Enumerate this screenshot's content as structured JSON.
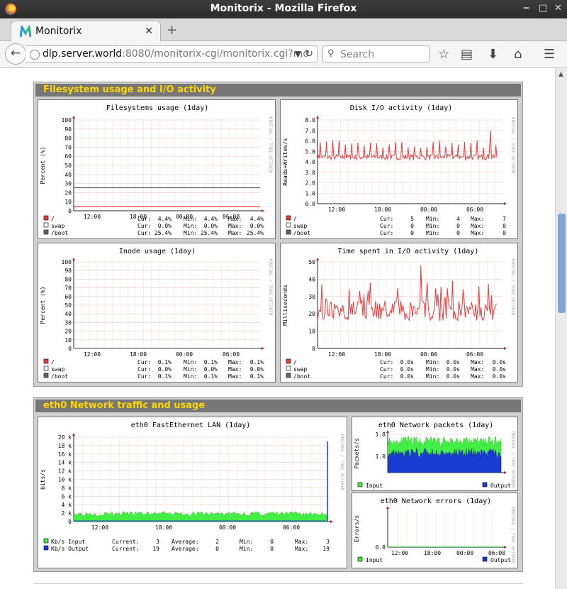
{
  "window": {
    "title": "Monitorix - Mozilla Firefox",
    "min": "‒",
    "max": "□",
    "close": "✕"
  },
  "tab": {
    "label": "Monitorix",
    "close": "✕",
    "new_tab": "+"
  },
  "nav": {
    "url_host": "dlp.server.world",
    "url_rest": ":8080/monitorix-cgi/monitorix.cgi?mo",
    "search_placeholder": "Search"
  },
  "sections": {
    "fs": "Filesystem usage and I/O activity",
    "net": "eth0 Network traffic and usage"
  },
  "watermark": "RRDTOOL / TOBI OETIKER",
  "colors": {
    "red": "#e83a3a",
    "gray": "#666666",
    "green": "#44ee44",
    "blue": "#1a3cd0",
    "accent": "#ffd700"
  },
  "graphs": {
    "fs_usage": {
      "title": "Filesystems usage  (1day)",
      "ylabel": "Percent (%)",
      "xticks": [
        "12:00",
        "18:00",
        "00:00",
        "06:00"
      ],
      "yticks": [
        "100",
        "90",
        "80",
        "70",
        "60",
        "50",
        "40",
        "30",
        "20",
        "10",
        "0"
      ],
      "legend": [
        {
          "name": "/",
          "cur": "4.4%",
          "min": "4.4%",
          "max": "4.4%"
        },
        {
          "name": "swap",
          "cur": "0.0%",
          "min": "0.0%",
          "max": "0.0%"
        },
        {
          "name": "/boot",
          "cur": "25.4%",
          "min": "25.4%",
          "max": "25.4%"
        }
      ]
    },
    "disk_io": {
      "title": "Disk I/O activity  (1day)",
      "ylabel": "Reads+Writes/s",
      "xticks": [
        "12:00",
        "18:00",
        "00:00",
        "06:00"
      ],
      "yticks": [
        "8.0",
        "7.0",
        "6.0",
        "5.0",
        "4.0",
        "3.0",
        "2.0",
        "1.0",
        "0.0"
      ],
      "legend": [
        {
          "name": "/",
          "cur": "5",
          "min": "4",
          "max": "7"
        },
        {
          "name": "swap",
          "cur": "0",
          "min": "0",
          "max": "0"
        },
        {
          "name": "/boot",
          "cur": "0",
          "min": "0",
          "max": "0"
        }
      ]
    },
    "inode": {
      "title": "Inode usage  (1day)",
      "ylabel": "Percent (%)",
      "xticks": [
        "12:00",
        "18:00",
        "00:00",
        "06:00"
      ],
      "yticks": [
        "100",
        "90",
        "80",
        "70",
        "60",
        "50",
        "40",
        "30",
        "20",
        "10",
        "0"
      ],
      "legend": [
        {
          "name": "/",
          "cur": "0.1%",
          "min": "0.1%",
          "max": "0.1%"
        },
        {
          "name": "swap",
          "cur": "0.0%",
          "min": "0.0%",
          "max": "0.0%"
        },
        {
          "name": "/boot",
          "cur": "0.1%",
          "min": "0.1%",
          "max": "0.1%"
        }
      ]
    },
    "io_time": {
      "title": "Time spent in I/O activity  (1day)",
      "ylabel": "Milliseconds",
      "xticks": [
        "12:00",
        "18:00",
        "00:00",
        "06:00"
      ],
      "yticks": [
        "50",
        "40",
        "30",
        "20",
        "10",
        "0"
      ],
      "legend": [
        {
          "name": "/",
          "cur": "0.0s",
          "min": "0.0s",
          "max": "0.0s"
        },
        {
          "name": "swap",
          "cur": "0.0s",
          "min": "0.0s",
          "max": "0.0s"
        },
        {
          "name": "/boot",
          "cur": "0.0s",
          "min": "0.0s",
          "max": "0.0s"
        }
      ]
    },
    "lan": {
      "title": "eth0 FastEthernet LAN  (1day)",
      "ylabel": "bits/s",
      "xticks": [
        "12:00",
        "18:00",
        "00:00",
        "06:00"
      ],
      "yticks": [
        "20 k",
        "18 k",
        "16 k",
        "14 k",
        "12 k",
        "10 k",
        "8 k",
        "6 k",
        "4 k",
        "2 k",
        "0"
      ],
      "legend": [
        {
          "name": "Kb/s Input",
          "current": "3",
          "average": "2",
          "min": "0",
          "max": "3"
        },
        {
          "name": "Kb/s Output",
          "current": "19",
          "average": "0",
          "min": "0",
          "max": "19"
        }
      ]
    },
    "packets": {
      "title": "eth0 Network packets  (1day)",
      "ylabel": "Packets/s",
      "yticks": [
        "1.8",
        "1.0"
      ],
      "legend": [
        "Input",
        "Output"
      ]
    },
    "errors": {
      "title": "eth0 Network errors  (1day)",
      "ylabel": "Errors/s",
      "xticks": [
        "12:00",
        "18:00",
        "00:00",
        "06:00"
      ],
      "yticks": [
        "0.0"
      ],
      "legend": [
        "Input",
        "Output"
      ]
    }
  },
  "legend_labels": {
    "cur": "Cur:",
    "min": "Min:",
    "max": "Max:",
    "current": "Current:",
    "average": "Average:"
  },
  "chart_data": [
    {
      "type": "line",
      "title": "Filesystems usage  (1day)",
      "ylabel": "Percent (%)",
      "ylim": [
        0,
        100
      ],
      "categories": [
        "12:00",
        "18:00",
        "00:00",
        "06:00"
      ],
      "series": [
        {
          "name": "/",
          "values": [
            4.4,
            4.4,
            4.4,
            4.4
          ]
        },
        {
          "name": "swap",
          "values": [
            0,
            0,
            0,
            0
          ]
        },
        {
          "name": "/boot",
          "values": [
            25.4,
            25.4,
            25.4,
            25.4
          ]
        }
      ]
    },
    {
      "type": "line",
      "title": "Disk I/O activity  (1day)",
      "ylabel": "Reads+Writes/s",
      "ylim": [
        0,
        8
      ],
      "categories": [
        "12:00",
        "18:00",
        "00:00",
        "06:00"
      ],
      "series": [
        {
          "name": "/",
          "values": [
            4.4,
            4.4,
            4.4,
            4.5
          ]
        }
      ]
    },
    {
      "type": "line",
      "title": "Inode usage  (1day)",
      "ylabel": "Percent (%)",
      "ylim": [
        0,
        100
      ],
      "categories": [
        "12:00",
        "18:00",
        "00:00",
        "06:00"
      ],
      "series": [
        {
          "name": "/",
          "values": [
            0.1,
            0.1,
            0.1,
            0.1
          ]
        },
        {
          "name": "/boot",
          "values": [
            0.1,
            0.1,
            0.1,
            0.1
          ]
        }
      ]
    },
    {
      "type": "line",
      "title": "Time spent in I/O activity  (1day)",
      "ylabel": "Milliseconds",
      "ylim": [
        0,
        50
      ],
      "categories": [
        "12:00",
        "18:00",
        "00:00",
        "06:00"
      ],
      "series": [
        {
          "name": "/",
          "values": [
            20,
            22,
            25,
            19
          ]
        }
      ]
    },
    {
      "type": "area",
      "title": "eth0 FastEthernet LAN  (1day)",
      "ylabel": "bits/s",
      "ylim": [
        0,
        20000
      ],
      "categories": [
        "12:00",
        "18:00",
        "00:00",
        "06:00"
      ],
      "series": [
        {
          "name": "Kb/s Input",
          "values": [
            1800,
            1800,
            1800,
            1800
          ]
        },
        {
          "name": "Kb/s Output",
          "values": [
            0,
            0,
            0,
            19000
          ]
        }
      ]
    },
    {
      "type": "area",
      "title": "eth0 Network packets  (1day)",
      "ylabel": "Packets/s",
      "ylim": [
        0,
        1.8
      ],
      "series": [
        {
          "name": "Input",
          "values": [
            1.4,
            1.4,
            1.4,
            1.4
          ]
        },
        {
          "name": "Output",
          "values": [
            0.9,
            0.9,
            0.9,
            0.9
          ]
        }
      ]
    },
    {
      "type": "line",
      "title": "eth0 Network errors  (1day)",
      "ylabel": "Errors/s",
      "ylim": [
        0,
        0.1
      ],
      "categories": [
        "12:00",
        "18:00",
        "00:00",
        "06:00"
      ],
      "series": [
        {
          "name": "Input",
          "values": [
            0,
            0,
            0,
            0
          ]
        },
        {
          "name": "Output",
          "values": [
            0,
            0,
            0,
            0
          ]
        }
      ]
    }
  ]
}
